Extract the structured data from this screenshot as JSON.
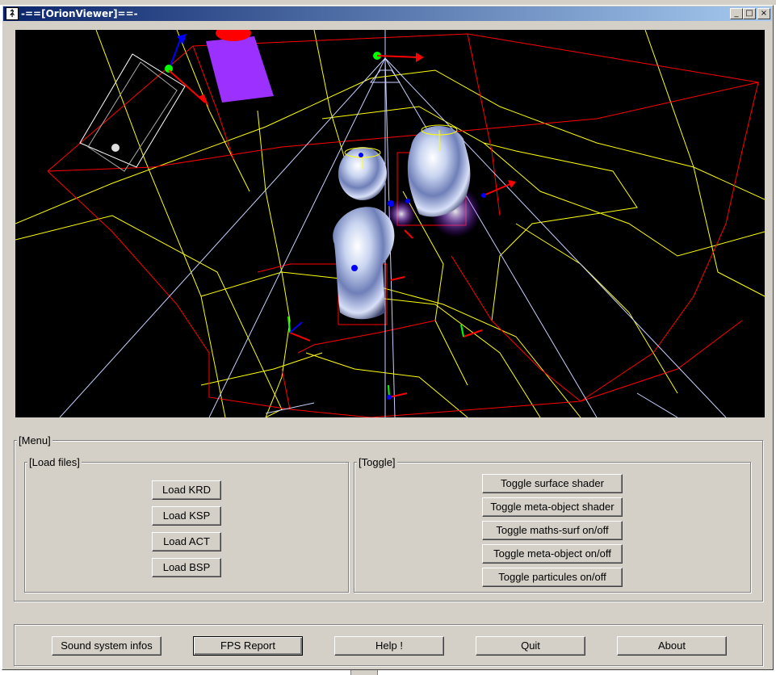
{
  "window": {
    "title": "-==[OrionViewer]==-",
    "controls": {
      "minimize": "_",
      "maximize": "□",
      "close": "×"
    }
  },
  "icons": {
    "app": "app-logo-icon",
    "minimize": "minimize-icon",
    "maximize": "maximize-icon",
    "close": "close-icon"
  },
  "colors": {
    "title_bar_start": "#0a246a",
    "title_bar_end": "#a6caf0",
    "viewport_bg": "#000000",
    "wire_yellow": "#ffff00",
    "wire_red": "#ff0000",
    "wire_white": "#ffffff",
    "cube_purple": "#9b30ff"
  },
  "menu": {
    "label": "[Menu]",
    "load_files": {
      "label": "[Load files]",
      "buttons": [
        "Load KRD",
        "Load KSP",
        "Load ACT",
        "Load BSP"
      ]
    },
    "toggle": {
      "label": "[Toggle]",
      "buttons": [
        "Toggle surface shader",
        "Toggle meta-object shader",
        "Toggle maths-surf on/off",
        "Toggle meta-object on/off",
        "Toggle particules on/off"
      ]
    }
  },
  "footer": {
    "buttons": [
      "Sound system infos",
      "FPS Report",
      "Help !",
      "Quit",
      "About"
    ]
  }
}
